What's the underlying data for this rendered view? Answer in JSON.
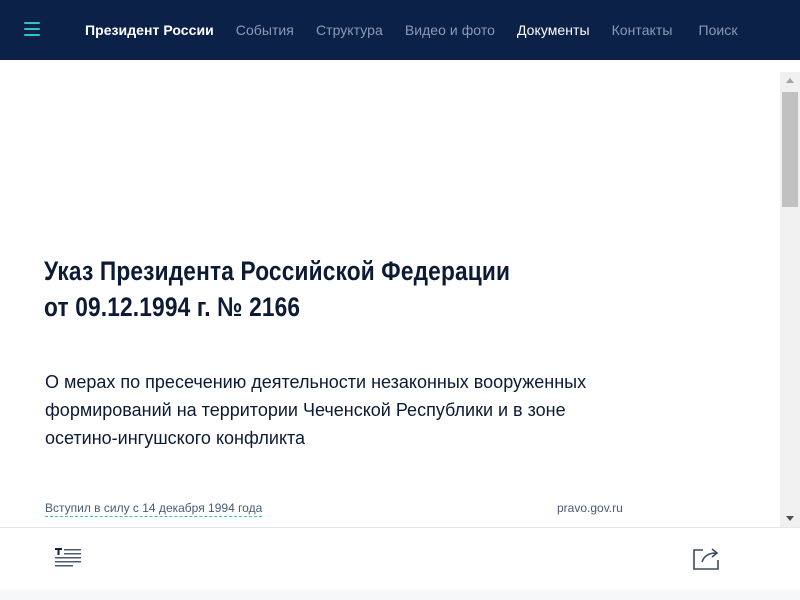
{
  "header": {
    "menu_icon": "hamburger-menu-icon",
    "brand": "Президент России",
    "nav": [
      {
        "label": "События",
        "active": false
      },
      {
        "label": "Структура",
        "active": false
      },
      {
        "label": "Видео и фото",
        "active": false
      },
      {
        "label": "Документы",
        "active": true
      },
      {
        "label": "Контакты",
        "active": false
      },
      {
        "label": "Поиск",
        "active": false
      }
    ]
  },
  "document": {
    "title_line1": "Указ Президента Российской Федерации",
    "title_line2": "от 09.12.1994 г. № 2166",
    "subtitle_line1": "О мерах по пресечению деятельности незаконных вооруженных",
    "subtitle_line2": "формирований на территории Чеченской Республики и в зоне",
    "subtitle_line3": "осетино-ингушского конфликта",
    "effective": "Вступил в силу с 14 декабря 1994 года",
    "source": "pravo.gov.ru"
  },
  "footer": {
    "toc_icon": "table-of-contents-icon",
    "share_icon": "share-icon"
  },
  "colors": {
    "header_bg": "#0c2147",
    "accent": "#2ec3c0",
    "text": "#0c1a33"
  }
}
